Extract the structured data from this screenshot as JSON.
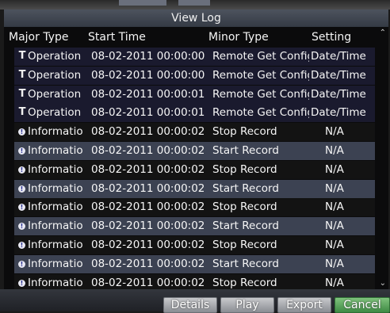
{
  "window": {
    "title": "View Log"
  },
  "columns": {
    "major_type": "Major Type",
    "start_time": "Start Time",
    "minor_type": "Minor Type",
    "setting": "Setting"
  },
  "rows": [
    {
      "icon": "operation-icon",
      "major": "Operation",
      "time": "08-02-2011  00:00:00",
      "minor": "Remote  Get  Config",
      "setting": "Date/Time"
    },
    {
      "icon": "operation-icon",
      "major": "Operation",
      "time": "08-02-2011  00:00:00",
      "minor": "Remote  Get  Config",
      "setting": "Date/Time"
    },
    {
      "icon": "operation-icon",
      "major": "Operation",
      "time": "08-02-2011  00:00:01",
      "minor": "Remote  Get  Config",
      "setting": "Date/Time"
    },
    {
      "icon": "operation-icon",
      "major": "Operation",
      "time": "08-02-2011  00:00:01",
      "minor": "Remote  Get  Config",
      "setting": "Date/Time"
    },
    {
      "icon": "information-icon",
      "major": "Informatio",
      "time": "08-02-2011  00:00:02",
      "minor": "Stop  Record",
      "setting": "N/A"
    },
    {
      "icon": "information-icon",
      "major": "Informatio",
      "time": "08-02-2011  00:00:02",
      "minor": "Start  Record",
      "setting": "N/A"
    },
    {
      "icon": "information-icon",
      "major": "Informatio",
      "time": "08-02-2011  00:00:02",
      "minor": "Stop  Record",
      "setting": "N/A"
    },
    {
      "icon": "information-icon",
      "major": "Informatio",
      "time": "08-02-2011  00:00:02",
      "minor": "Start  Record",
      "setting": "N/A"
    },
    {
      "icon": "information-icon",
      "major": "Informatio",
      "time": "08-02-2011  00:00:02",
      "minor": "Stop  Record",
      "setting": "N/A"
    },
    {
      "icon": "information-icon",
      "major": "Informatio",
      "time": "08-02-2011  00:00:02",
      "minor": "Start  Record",
      "setting": "N/A"
    },
    {
      "icon": "information-icon",
      "major": "Informatio",
      "time": "08-02-2011  00:00:02",
      "minor": "Stop  Record",
      "setting": "N/A"
    },
    {
      "icon": "information-icon",
      "major": "Informatio",
      "time": "08-02-2011  00:00:02",
      "minor": "Start  Record",
      "setting": "N/A"
    },
    {
      "icon": "information-icon",
      "major": "Informatio",
      "time": "08-02-2011  00:00:02",
      "minor": "Stop  Record",
      "setting": "N/A"
    }
  ],
  "scroll": {
    "up_icon": "chevron-up-icon",
    "down_icon": "chevron-down-icon"
  },
  "buttons": {
    "details": "Details",
    "play": "Play",
    "export": "Export",
    "cancel": "Cancel"
  },
  "colors": {
    "title_bar": "#3f4550",
    "row_light": "#3c4252",
    "row_dark": "#131313",
    "cancel_button": "#4f9e52"
  }
}
